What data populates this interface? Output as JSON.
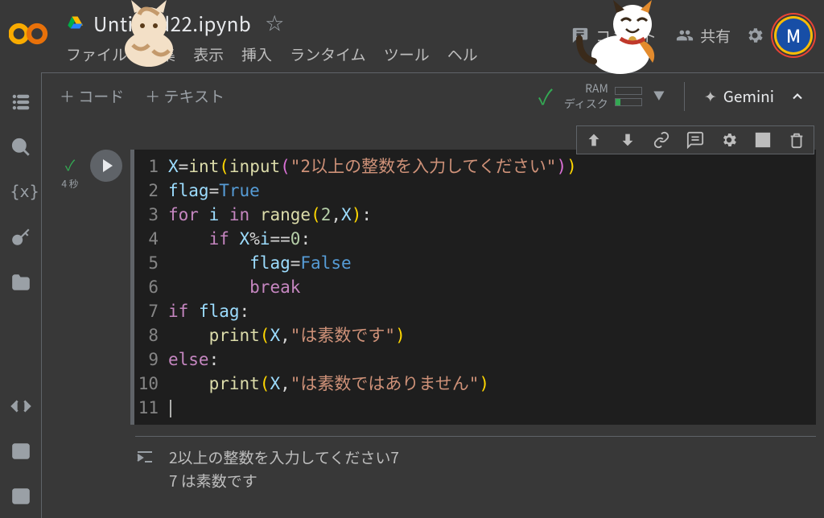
{
  "header": {
    "filename": "Untitled22.ipynb",
    "menus": [
      "ファイル",
      "編集",
      "表示",
      "挿入",
      "ランタイム",
      "ツール",
      "ヘル"
    ],
    "comment_label": "コメント",
    "share_label": "共有",
    "avatar_letter": "M"
  },
  "toolbar": {
    "code_btn": "＋ コード",
    "text_btn": "＋ テキスト",
    "ram_label": "RAM",
    "disk_label": "ディスク",
    "gemini_label": "Gemini"
  },
  "cell": {
    "exec_time": "4 秒",
    "lines": [
      [
        {
          "t": "X",
          "c": "tk-var"
        },
        {
          "t": "=",
          "c": "tk-op"
        },
        {
          "t": "int",
          "c": "tk-func"
        },
        {
          "t": "(",
          "c": "tk-pun"
        },
        {
          "t": "input",
          "c": "tk-func"
        },
        {
          "t": "(",
          "c": "tk-pun2"
        },
        {
          "t": "\"2以上の整数を入力してください\"",
          "c": "tk-str"
        },
        {
          "t": ")",
          "c": "tk-pun2"
        },
        {
          "t": ")",
          "c": "tk-pun"
        }
      ],
      [
        {
          "t": "flag",
          "c": "tk-var"
        },
        {
          "t": "=",
          "c": "tk-op"
        },
        {
          "t": "True",
          "c": "tk-bool"
        }
      ],
      [
        {
          "t": "for",
          "c": "tk-kw"
        },
        {
          "t": " ",
          "c": ""
        },
        {
          "t": "i",
          "c": "tk-var"
        },
        {
          "t": " ",
          "c": ""
        },
        {
          "t": "in",
          "c": "tk-kw"
        },
        {
          "t": " ",
          "c": ""
        },
        {
          "t": "range",
          "c": "tk-func"
        },
        {
          "t": "(",
          "c": "tk-pun"
        },
        {
          "t": "2",
          "c": "tk-num"
        },
        {
          "t": ",",
          "c": "tk-op"
        },
        {
          "t": "X",
          "c": "tk-var"
        },
        {
          "t": ")",
          "c": "tk-pun"
        },
        {
          "t": ":",
          "c": "tk-op"
        }
      ],
      [
        {
          "t": "    ",
          "c": ""
        },
        {
          "t": "if",
          "c": "tk-kw"
        },
        {
          "t": " ",
          "c": ""
        },
        {
          "t": "X",
          "c": "tk-var"
        },
        {
          "t": "%",
          "c": "tk-op"
        },
        {
          "t": "i",
          "c": "tk-var"
        },
        {
          "t": "==",
          "c": "tk-op"
        },
        {
          "t": "0",
          "c": "tk-num"
        },
        {
          "t": ":",
          "c": "tk-op"
        }
      ],
      [
        {
          "t": "        ",
          "c": ""
        },
        {
          "t": "flag",
          "c": "tk-var"
        },
        {
          "t": "=",
          "c": "tk-op"
        },
        {
          "t": "False",
          "c": "tk-bool"
        }
      ],
      [
        {
          "t": "        ",
          "c": ""
        },
        {
          "t": "break",
          "c": "tk-kw"
        }
      ],
      [
        {
          "t": "if",
          "c": "tk-kw"
        },
        {
          "t": " ",
          "c": ""
        },
        {
          "t": "flag",
          "c": "tk-var"
        },
        {
          "t": ":",
          "c": "tk-op"
        }
      ],
      [
        {
          "t": "    ",
          "c": ""
        },
        {
          "t": "print",
          "c": "tk-func"
        },
        {
          "t": "(",
          "c": "tk-pun"
        },
        {
          "t": "X",
          "c": "tk-var"
        },
        {
          "t": ",",
          "c": "tk-op"
        },
        {
          "t": "\"は素数です\"",
          "c": "tk-str"
        },
        {
          "t": ")",
          "c": "tk-pun"
        }
      ],
      [
        {
          "t": "else",
          "c": "tk-kw"
        },
        {
          "t": ":",
          "c": "tk-op"
        }
      ],
      [
        {
          "t": "    ",
          "c": ""
        },
        {
          "t": "print",
          "c": "tk-func"
        },
        {
          "t": "(",
          "c": "tk-pun"
        },
        {
          "t": "X",
          "c": "tk-var"
        },
        {
          "t": ",",
          "c": "tk-op"
        },
        {
          "t": "\"は素数ではありません\"",
          "c": "tk-str"
        },
        {
          "t": ")",
          "c": "tk-pun"
        }
      ],
      []
    ],
    "output_lines": [
      "2以上の整数を入力してください7",
      "7 は素数です"
    ]
  }
}
